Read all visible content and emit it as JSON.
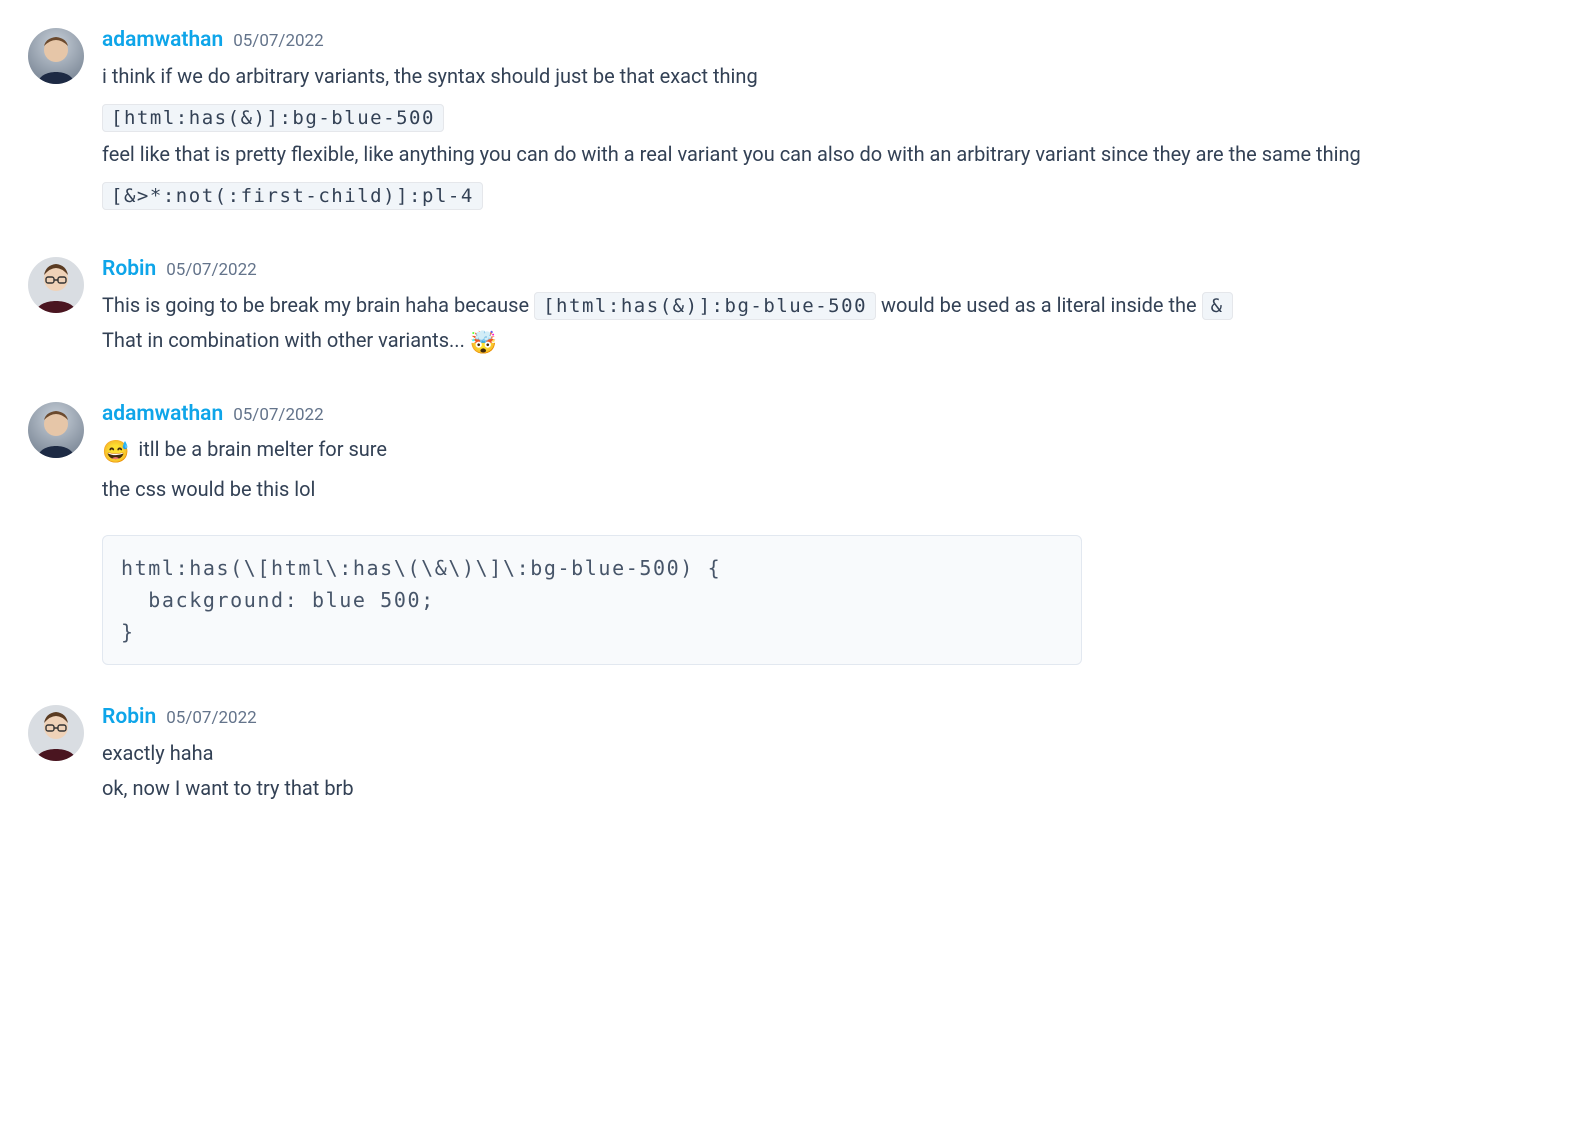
{
  "messages": [
    {
      "author": "adamwathan",
      "avatar": "adam",
      "timestamp": "05/07/2022",
      "lines": [
        {
          "type": "text",
          "text": "i think if we do arbitrary variants, the syntax should just be that exact thing"
        },
        {
          "type": "code",
          "text": "[html:has(&)]:bg-blue-500"
        },
        {
          "type": "text",
          "text": "feel like that is pretty flexible, like anything you can do with  a real variant you can also do with an arbitrary variant since they are the same thing"
        },
        {
          "type": "code",
          "text": "[&>*:not(:first-child)]:pl-4"
        }
      ]
    },
    {
      "author": "Robin",
      "avatar": "robin",
      "timestamp": "05/07/2022",
      "lines": [
        {
          "type": "mixed",
          "parts": [
            {
              "kind": "text",
              "text": "This is going to be break my brain haha because "
            },
            {
              "kind": "code",
              "text": "[html:has(&)]:bg-blue-500"
            },
            {
              "kind": "text",
              "text": " would be used as a literal inside the "
            },
            {
              "kind": "code",
              "text": "&"
            }
          ]
        },
        {
          "type": "mixed",
          "parts": [
            {
              "kind": "text",
              "text": "That in combination with other variants... "
            },
            {
              "kind": "emoji",
              "text": "🤯"
            }
          ]
        }
      ]
    },
    {
      "author": "adamwathan",
      "avatar": "adam",
      "timestamp": "05/07/2022",
      "lines": [
        {
          "type": "mixed",
          "parts": [
            {
              "kind": "emoji",
              "text": "😅"
            },
            {
              "kind": "text",
              "text": " itll be a brain melter for sure"
            }
          ]
        },
        {
          "type": "text",
          "text": "the css would be this lol"
        },
        {
          "type": "block",
          "text": "html:has(\\[html\\:has\\(\\&\\)\\]\\:bg-blue-500) {\n  background: blue 500;\n}"
        }
      ]
    },
    {
      "author": "Robin",
      "avatar": "robin",
      "timestamp": "05/07/2022",
      "lines": [
        {
          "type": "text",
          "text": "exactly haha"
        },
        {
          "type": "text",
          "text": "ok, now I want to try that brb"
        }
      ]
    }
  ]
}
